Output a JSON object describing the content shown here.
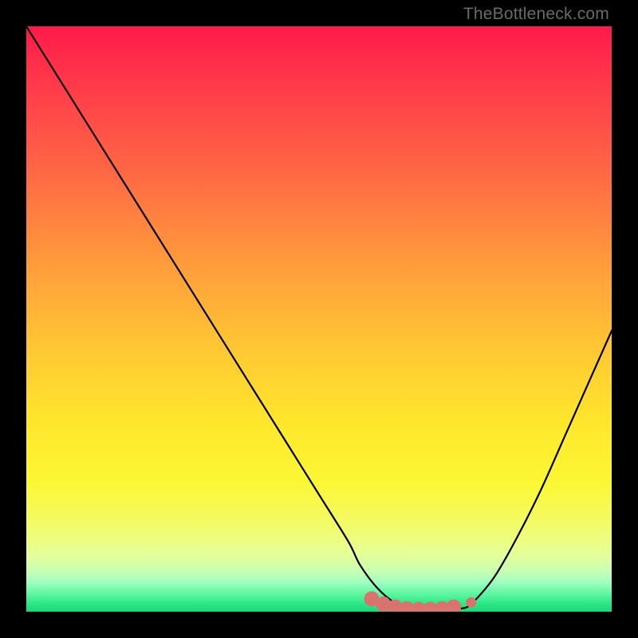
{
  "watermark": "TheBottleneck.com",
  "colors": {
    "frame": "#000000",
    "curve": "#000000",
    "marker_fill": "#d9736f",
    "marker_stroke": "#c85e5b"
  },
  "chart_data": {
    "type": "line",
    "title": "",
    "xlabel": "",
    "ylabel": "",
    "xlim": [
      0,
      100
    ],
    "ylim": [
      0,
      100
    ],
    "grid": false,
    "legend": false,
    "series": [
      {
        "name": "bottleneck-curve",
        "x": [
          0,
          5,
          10,
          15,
          20,
          25,
          30,
          35,
          40,
          45,
          50,
          55,
          57,
          60,
          63,
          66,
          69,
          72,
          74,
          76,
          80,
          84,
          88,
          92,
          96,
          100
        ],
        "y": [
          100,
          92,
          84,
          76,
          68,
          60,
          52,
          44,
          36,
          28,
          20,
          12,
          8,
          4,
          1.5,
          0.5,
          0.3,
          0.3,
          0.5,
          1.3,
          6,
          13,
          21,
          30,
          39,
          48
        ]
      }
    ],
    "markers": {
      "name": "highlight-band",
      "x": [
        59,
        61,
        63,
        65,
        67,
        69,
        71,
        73,
        76
      ],
      "y": [
        2.2,
        1.3,
        0.8,
        0.5,
        0.4,
        0.4,
        0.5,
        0.8,
        1.6
      ]
    }
  }
}
